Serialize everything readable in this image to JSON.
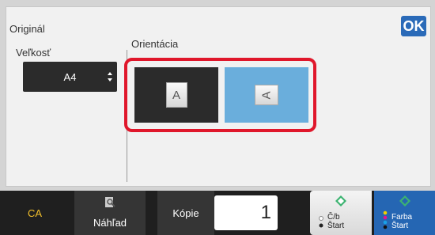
{
  "original_label": "Originál",
  "ok_label": "OK",
  "size": {
    "label": "Veľkosť",
    "value": "A4"
  },
  "orientation": {
    "label": "Orientácia",
    "portrait_glyph": "A",
    "landscape_glyph": "A",
    "selected": "landscape"
  },
  "bottom_bar": {
    "ca_label": "CA",
    "preview_label": "Náhľad",
    "copies_label": "Kópie",
    "copies_value": "1",
    "bw_start_label": "Č/b\nŠtart",
    "bw_line1": "Č/b",
    "bw_line2": "Štart",
    "color_line1": "Farba",
    "color_line2": "Štart"
  },
  "colors": {
    "accent": "#2a6ab8",
    "selected_orientation": "#6aaedc",
    "highlight_frame": "#e0172b",
    "ca_text": "#f3c02b",
    "start_green": "#3cb371"
  }
}
